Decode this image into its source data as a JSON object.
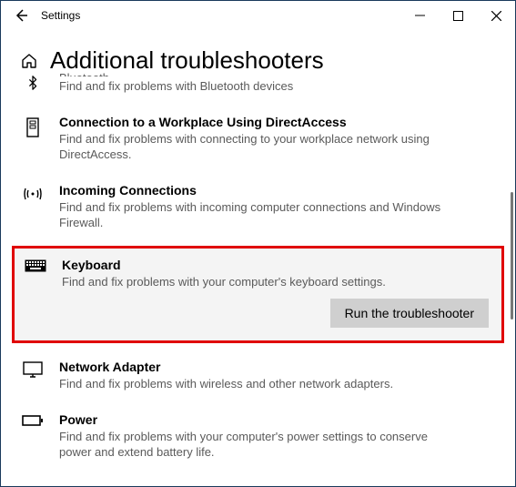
{
  "window": {
    "title": "Settings"
  },
  "page": {
    "heading": "Additional troubleshooters"
  },
  "items": {
    "bluetooth": {
      "title_cut": "Bluetooth",
      "desc": "Find and fix problems with Bluetooth devices"
    },
    "directaccess": {
      "title": "Connection to a Workplace Using DirectAccess",
      "desc": "Find and fix problems with connecting to your workplace network using DirectAccess."
    },
    "incoming": {
      "title": "Incoming Connections",
      "desc": "Find and fix problems with incoming computer connections and Windows Firewall."
    },
    "keyboard": {
      "title": "Keyboard",
      "desc": "Find and fix problems with your computer's keyboard settings.",
      "button": "Run the troubleshooter"
    },
    "network": {
      "title": "Network Adapter",
      "desc": "Find and fix problems with wireless and other network adapters."
    },
    "power": {
      "title": "Power",
      "desc": "Find and fix problems with your computer's power settings to conserve power and extend battery life."
    }
  }
}
